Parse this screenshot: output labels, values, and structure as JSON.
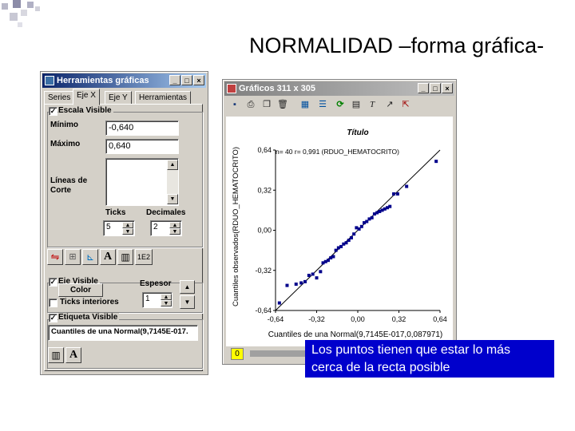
{
  "slide": {
    "title": "NORMALIDAD –forma gráfica-",
    "callout": [
      "Los puntos tienen que estar lo más",
      "cerca de la recta posible"
    ]
  },
  "tools_window": {
    "title": "Herramientas gráficas",
    "controls": [
      "_",
      "□",
      "×"
    ],
    "tabs": [
      "Series",
      "Eje X",
      "Eje Y",
      "Herramientas"
    ],
    "active_tab": "Eje X",
    "scale_visible": {
      "label": "Escala Visible",
      "checked": true
    },
    "min_label": "Mínimo",
    "min_value": "-0,640",
    "max_label": "Máximo",
    "max_value": "0,640",
    "cut_lines_label": [
      "Líneas de",
      "Corte"
    ],
    "ticks_label": "Ticks",
    "ticks_value": "5",
    "decimals_label": "Decimales",
    "decimals_value": "2",
    "toolbar_icons": [
      "swap-icon",
      "grid-icon",
      "axis-icon",
      "font-icon",
      "bars-icon",
      "sci-notation-icon"
    ],
    "sci_label": "1E2",
    "font_label": "A",
    "axis_visible": {
      "label": "Eje Visible",
      "checked": true
    },
    "color_button": "Color",
    "inner_ticks": {
      "label": "Ticks interiores",
      "checked": false
    },
    "thickness_label": "Espesor",
    "thickness_value": "1",
    "label_visible": {
      "label": "Etiqueta Visible",
      "checked": true
    },
    "axis_label_value": "Cuantiles de una Normal(9,7145E-017."
  },
  "graph_window": {
    "title": "Gráficos 311 x 305",
    "controls": [
      "_",
      "□",
      "×"
    ],
    "toolbar_icons": [
      "save-icon",
      "print-icon",
      "copy-icon",
      "delete-icon",
      "chart-icon",
      "list-icon",
      "refresh-icon",
      "clipboard-icon",
      "text-icon",
      "arrow-icon",
      "select-icon"
    ],
    "page_indicator": "0"
  },
  "chart_data": {
    "type": "scatter",
    "title": "Título",
    "annotation": "n= 40 r= 0,991 (RDUO_HEMATOCRITO)",
    "xlabel": "Cuantiles de una Normal(9,7145E-017,0,087971)",
    "ylabel": "Cuantiles observados(RDUO_HEMATOCRITO)",
    "xlim": [
      -0.64,
      0.64
    ],
    "ylim": [
      -0.64,
      0.64
    ],
    "xticks": [
      "-0,64",
      "-0,32",
      "0,00",
      "0,32",
      "0,64"
    ],
    "yticks": [
      "0,64",
      "0,32",
      "0,00",
      "-0,32",
      "-0,64"
    ],
    "reference_line": [
      [
        -0.64,
        -0.64
      ],
      [
        0.64,
        0.64
      ]
    ],
    "point_color": "#00008b",
    "x": [
      -0.61,
      -0.55,
      -0.48,
      -0.44,
      -0.41,
      -0.38,
      -0.35,
      -0.32,
      -0.29,
      -0.27,
      -0.25,
      -0.23,
      -0.21,
      -0.19,
      -0.17,
      -0.15,
      -0.13,
      -0.11,
      -0.09,
      -0.07,
      -0.05,
      -0.03,
      -0.01,
      0.01,
      0.03,
      0.05,
      0.07,
      0.09,
      0.11,
      0.13,
      0.15,
      0.17,
      0.19,
      0.21,
      0.23,
      0.25,
      0.28,
      0.31,
      0.38,
      0.61
    ],
    "y": [
      -0.58,
      -0.44,
      -0.43,
      -0.42,
      -0.41,
      -0.36,
      -0.35,
      -0.38,
      -0.33,
      -0.26,
      -0.25,
      -0.24,
      -0.22,
      -0.21,
      -0.16,
      -0.14,
      -0.13,
      -0.11,
      -0.1,
      -0.08,
      -0.06,
      -0.03,
      0.02,
      0.01,
      0.03,
      0.06,
      0.07,
      0.09,
      0.1,
      0.13,
      0.14,
      0.15,
      0.16,
      0.17,
      0.18,
      0.19,
      0.29,
      0.29,
      0.35,
      0.55
    ]
  }
}
